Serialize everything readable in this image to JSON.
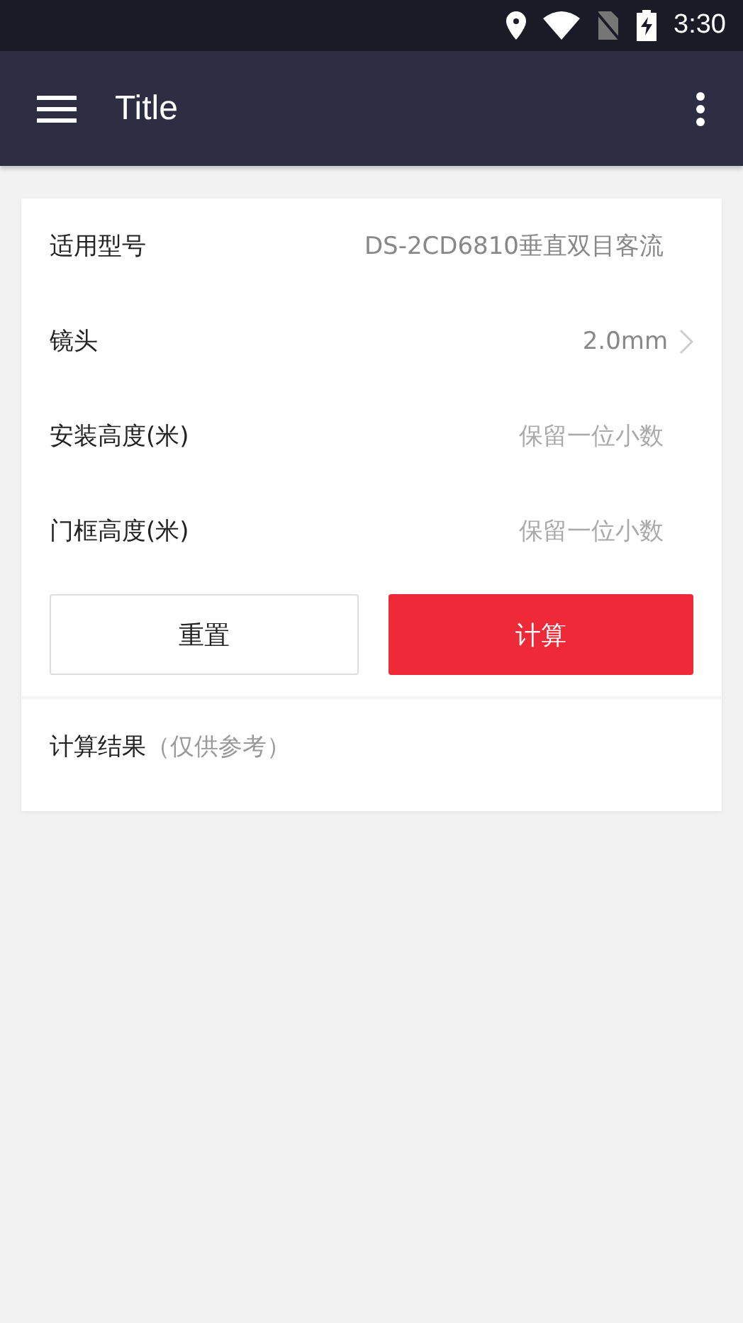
{
  "status_bar": {
    "time": "3:30"
  },
  "app_bar": {
    "title": "Title"
  },
  "form": {
    "rows": [
      {
        "kind": "value",
        "label": "适用型号",
        "value": "DS-2CD6810垂直双目客流"
      },
      {
        "kind": "select",
        "label": "镜头",
        "value": "2.0mm"
      },
      {
        "kind": "input",
        "label": "安装高度(米)",
        "placeholder": "保留一位小数"
      },
      {
        "kind": "input",
        "label": "门框高度(米)",
        "placeholder": "保留一位小数"
      }
    ],
    "buttons": [
      {
        "kind": "secondary",
        "label": "重置"
      },
      {
        "kind": "primary",
        "label": "计算"
      }
    ]
  },
  "result": {
    "title": "计算结果",
    "note": "（仅供参考）"
  }
}
